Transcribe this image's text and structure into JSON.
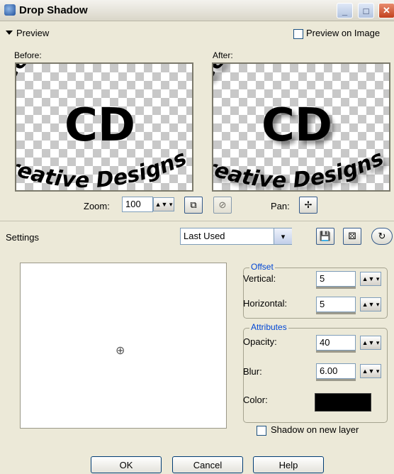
{
  "window": {
    "title": "Drop Shadow"
  },
  "preview": {
    "toggle_label": "Preview",
    "preview_on_image_label": "Preview on Image",
    "before_label": "Before:",
    "after_label": "After:",
    "image_text_top": "laureen's Artz",
    "image_text_bottom": "reative Designs",
    "image_initials": "CD"
  },
  "zoom": {
    "label": "Zoom:",
    "value": "100"
  },
  "pan": {
    "label": "Pan:"
  },
  "settings": {
    "label": "Settings",
    "selected": "Last Used"
  },
  "offset": {
    "title": "Offset",
    "vertical_label": "Vertical:",
    "vertical_value": "5",
    "horizontal_label": "Horizontal:",
    "horizontal_value": "5"
  },
  "attributes": {
    "title": "Attributes",
    "opacity_label": "Opacity:",
    "opacity_value": "40",
    "blur_label": "Blur:",
    "blur_value": "6.00",
    "color_label": "Color:",
    "color_value": "#000000"
  },
  "shadow_on_new_layer_label": "Shadow on new layer",
  "buttons": {
    "ok": "OK",
    "cancel": "Cancel",
    "help": "Help"
  }
}
